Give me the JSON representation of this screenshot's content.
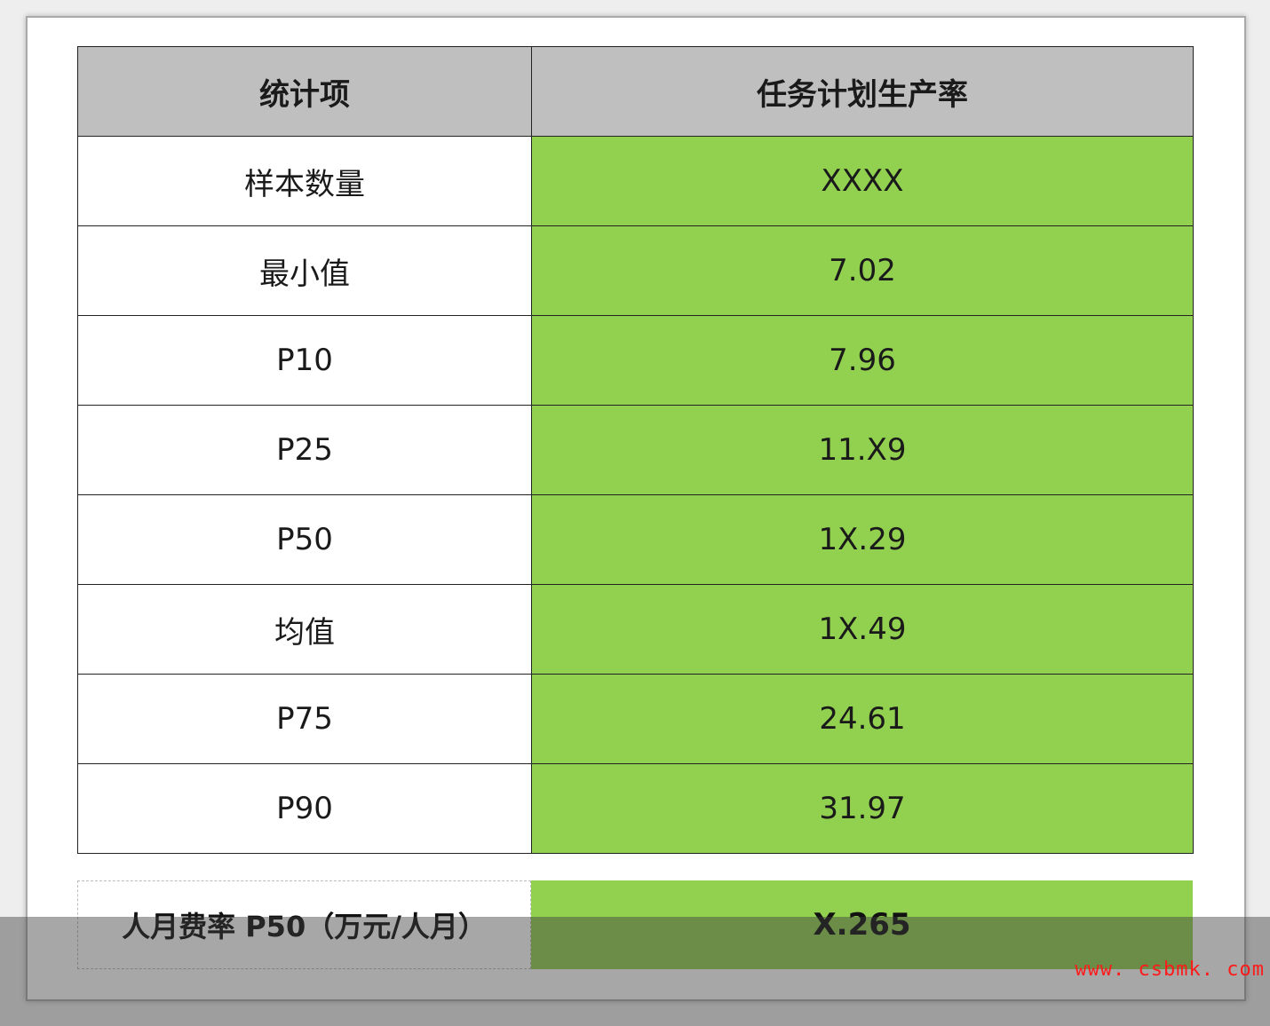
{
  "table": {
    "headers": [
      "统计项",
      "任务计划生产率"
    ],
    "rows": [
      {
        "label": "样本数量",
        "value": "XXXX"
      },
      {
        "label": "最小值",
        "value": "7.02"
      },
      {
        "label": "P10",
        "value": "7.96"
      },
      {
        "label": "P25",
        "value": "11.X9"
      },
      {
        "label": "P50",
        "value": "1X.29"
      },
      {
        "label": "均值",
        "value": "1X.49"
      },
      {
        "label": "P75",
        "value": "24.61"
      },
      {
        "label": "P90",
        "value": "31.97"
      }
    ]
  },
  "summary": {
    "label": "人月费率 P50（万元/人月）",
    "value": "X.265"
  },
  "watermark": "www. csbmk. com",
  "colors": {
    "header_bg": "#bfbfbf",
    "value_bg": "#92d050",
    "watermark": "#ff1a1a"
  }
}
